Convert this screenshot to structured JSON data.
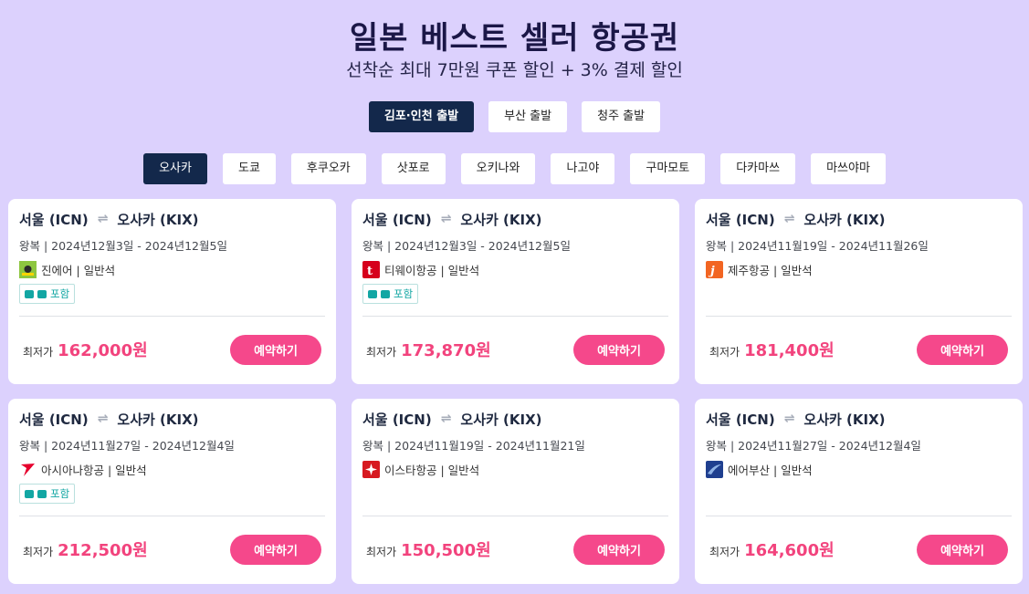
{
  "header": {
    "title": "일본 베스트 셀러 항공권",
    "subtitle": "선착순 최대 7만원 쿠폰 할인 + 3% 결제 할인"
  },
  "departures": [
    {
      "label": "김포·인천 출발",
      "active": true
    },
    {
      "label": "부산 출발",
      "active": false
    },
    {
      "label": "청주 출발",
      "active": false
    }
  ],
  "cities": [
    {
      "label": "오사카",
      "active": true
    },
    {
      "label": "도쿄",
      "active": false
    },
    {
      "label": "후쿠오카",
      "active": false
    },
    {
      "label": "삿포로",
      "active": false
    },
    {
      "label": "오키나와",
      "active": false
    },
    {
      "label": "나고야",
      "active": false
    },
    {
      "label": "구마모토",
      "active": false
    },
    {
      "label": "다카마쓰",
      "active": false
    },
    {
      "label": "마쓰야마",
      "active": false
    }
  ],
  "common": {
    "origin": "서울 (ICN)",
    "destination": "오사카 (KIX)",
    "price_label": "최저가",
    "book_label": "예약하기",
    "baggage_label": "포함",
    "arrow": "⇌"
  },
  "cards": [
    {
      "dates": "왕복 | 2024년12월3일 - 2024년12월5일",
      "airline": "진에어 | 일반석",
      "logo": "jinair-logo",
      "logo_color": "#8dc63f",
      "baggage": true,
      "price": "162,000원"
    },
    {
      "dates": "왕복 | 2024년12월3일 - 2024년12월5일",
      "airline": "티웨이항공 | 일반석",
      "logo": "tway-logo",
      "logo_color": "#d6001c",
      "baggage": true,
      "price": "173,870원"
    },
    {
      "dates": "왕복 | 2024년11월19일 - 2024년11월26일",
      "airline": "제주항공 | 일반석",
      "logo": "jejuair-logo",
      "logo_color": "#f26522",
      "baggage": false,
      "price": "181,400원"
    },
    {
      "dates": "왕복 | 2024년11월27일 - 2024년12월4일",
      "airline": "아시아나항공 | 일반석",
      "logo": "asiana-logo",
      "logo_color": "#e6002d",
      "baggage": true,
      "price": "212,500원"
    },
    {
      "dates": "왕복 | 2024년11월19일 - 2024년11월21일",
      "airline": "이스타항공 | 일반석",
      "logo": "eastar-logo",
      "logo_color": "#d71920",
      "baggage": false,
      "price": "150,500원"
    },
    {
      "dates": "왕복 | 2024년11월27일 - 2024년12월4일",
      "airline": "에어부산 | 일반석",
      "logo": "airbusan-logo",
      "logo_color": "#1f3f8f",
      "baggage": false,
      "price": "164,600원"
    }
  ]
}
